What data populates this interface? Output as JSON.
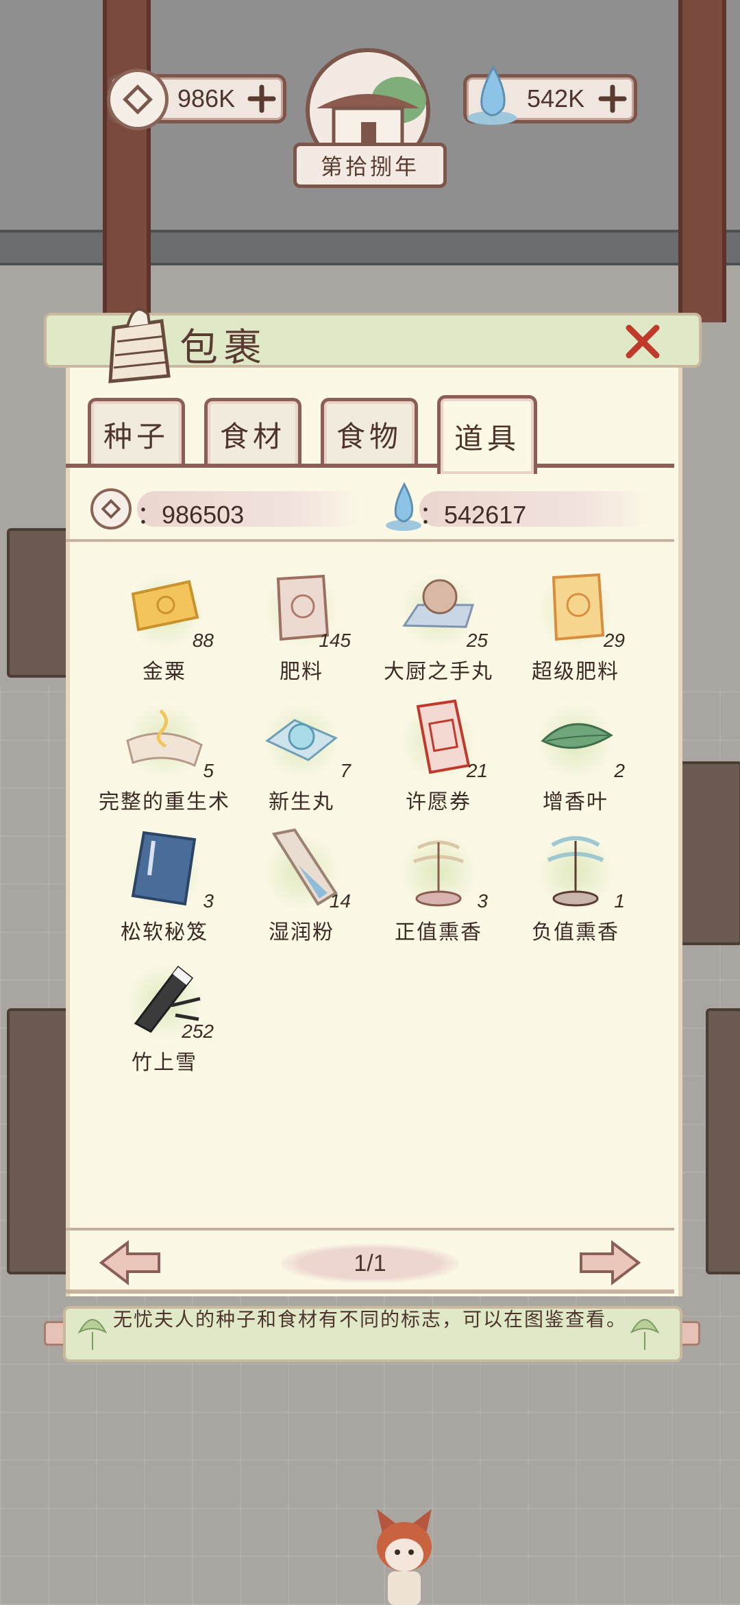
{
  "hud": {
    "coins": "986K",
    "water": "542K",
    "year_label": "第拾捌年"
  },
  "panel": {
    "title": "包裹",
    "tabs": [
      {
        "label": "种子",
        "active": false
      },
      {
        "label": "食材",
        "active": false
      },
      {
        "label": "食物",
        "active": false
      },
      {
        "label": "道具",
        "active": true
      }
    ],
    "coin_amount": "：986503",
    "water_amount": "：542617",
    "items": [
      {
        "name": "金粟",
        "count": "88",
        "icon": "gold-packet-icon"
      },
      {
        "name": "肥料",
        "count": "145",
        "icon": "fertilizer-bag-icon"
      },
      {
        "name": "大厨之手丸",
        "count": "25",
        "icon": "pearl-pill-icon"
      },
      {
        "name": "超级肥料",
        "count": "29",
        "icon": "super-fertilizer-icon"
      },
      {
        "name": "完整的重生术",
        "count": "5",
        "icon": "rebirth-scroll-icon"
      },
      {
        "name": "新生丸",
        "count": "7",
        "icon": "crystal-pill-icon"
      },
      {
        "name": "许愿券",
        "count": "21",
        "icon": "wish-ticket-icon"
      },
      {
        "name": "增香叶",
        "count": "2",
        "icon": "green-leaf-icon"
      },
      {
        "name": "松软秘笈",
        "count": "3",
        "icon": "blue-book-icon"
      },
      {
        "name": "湿润粉",
        "count": "14",
        "icon": "blue-powder-scoop-icon"
      },
      {
        "name": "正值熏香",
        "count": "3",
        "icon": "incense-burner-icon"
      },
      {
        "name": "负值熏香",
        "count": "1",
        "icon": "blue-incense-icon"
      },
      {
        "name": "竹上雪",
        "count": "252",
        "icon": "bamboo-snow-icon"
      }
    ],
    "page_indicator": "1/1"
  },
  "tip": "无忧夫人的种子和食材有不同的标志，可以在图鉴查看。",
  "colors": {
    "panel_bg": "#fbf8e6",
    "border_brown": "#8b5f55",
    "scroll_green": "#dfe9c8",
    "close_red": "#c0392b"
  }
}
